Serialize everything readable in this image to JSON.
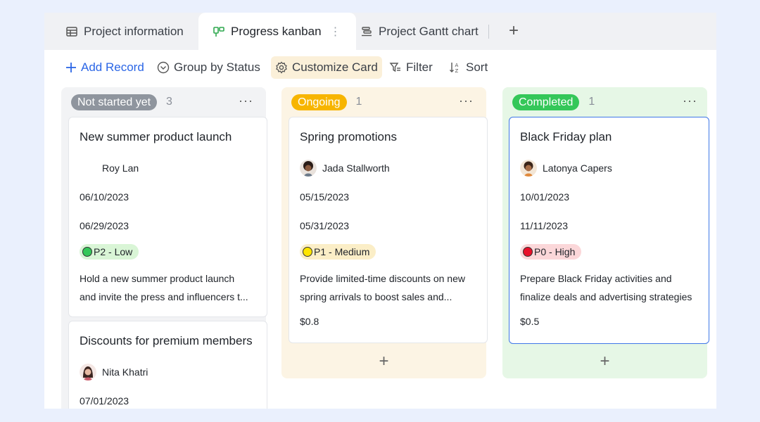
{
  "tabs": [
    {
      "label": "Project information",
      "icon": "table-icon"
    },
    {
      "label": "Progress kanban",
      "icon": "kanban-icon",
      "more": "⋮"
    },
    {
      "label": "Project Gantt chart",
      "icon": "gantt-icon"
    }
  ],
  "tab_add": "+",
  "toolbar": {
    "add_record": "Add Record",
    "group_by": "Group by Status",
    "customize": "Customize Card",
    "filter": "Filter",
    "sort": "Sort"
  },
  "colors": {
    "not_started": "#8f959e",
    "ongoing": "#f7b500",
    "completed": "#34c759",
    "accent": "#2b66e6"
  },
  "columns": [
    {
      "status": "Not started yet",
      "count": "3",
      "more": "···",
      "cards": [
        {
          "title": "New summer product launch",
          "person": "Roy Lan",
          "start": "06/10/2023",
          "end": "06/29/2023",
          "priority": "P2 - Low",
          "desc1": "Hold a new summer product launch",
          "desc2": "and invite the press and influencers t..."
        },
        {
          "title": "Discounts for premium members",
          "person": "Nita Khatri",
          "start": "07/01/2023"
        }
      ]
    },
    {
      "status": "Ongoing",
      "count": "1",
      "more": "···",
      "add": "+",
      "cards": [
        {
          "title": "Spring promotions",
          "person": "Jada Stallworth",
          "start": "05/15/2023",
          "end": "05/31/2023",
          "priority": "P1 - Medium",
          "desc1": "Provide limited-time discounts on new",
          "desc2": "spring arrivals to boost sales and...",
          "amount": "$0.8"
        }
      ]
    },
    {
      "status": "Completed",
      "count": "1",
      "more": "···",
      "add": "+",
      "cards": [
        {
          "title": "Black Friday plan",
          "person": "Latonya Capers",
          "start": "10/01/2023",
          "end": "11/11/2023",
          "priority": "P0 - High",
          "desc1": "Prepare Black Friday activities and",
          "desc2": "finalize deals and advertising strategies",
          "amount": "$0.5"
        }
      ]
    }
  ]
}
